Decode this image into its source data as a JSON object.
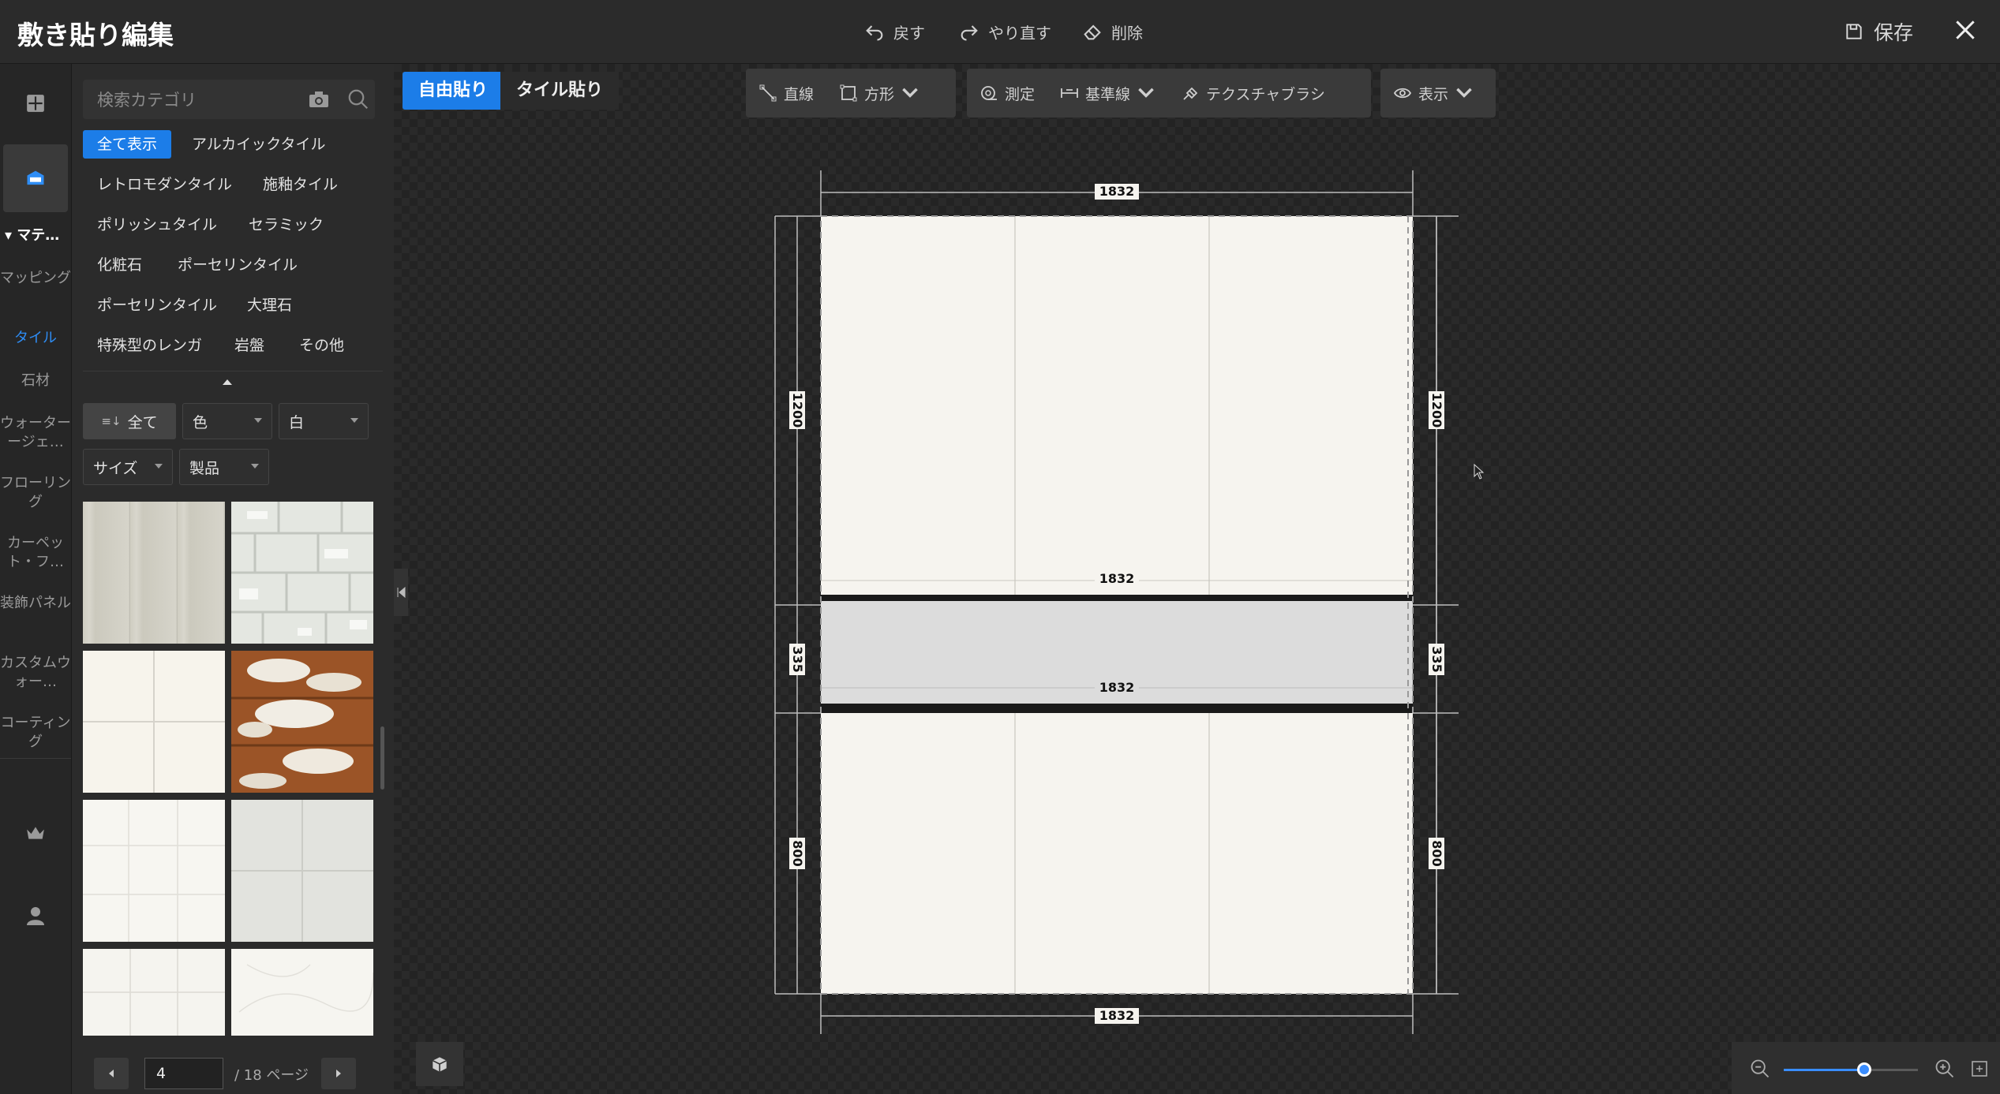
{
  "header": {
    "title": "敷き貼り編集",
    "undo_label": "戻す",
    "redo_label": "やり直す",
    "delete_label": "削除",
    "save_label": "保存"
  },
  "rail": {
    "section_label": "マテ…",
    "items": [
      "マッピング",
      "タイル",
      "石材",
      "ウォーターージェ…",
      "フローリング",
      "カーペット・フ…",
      "装飾パネル",
      "カスタムウォー…",
      "コーティング"
    ],
    "active_item": "タイル",
    "accent_color": "#1c7de8"
  },
  "panel": {
    "search_placeholder": "検索カテゴリ",
    "tags": [
      "全て表示",
      "アルカイックタイル",
      "レトロモダンタイル",
      "施釉タイル",
      "ポリッシュタイル",
      "セラミック",
      "化粧石",
      "ポーセリンタイル",
      "ポーセリンタイル",
      "大理石",
      "特殊型のレンガ",
      "岩盤",
      "その他"
    ],
    "active_tag": "全て表示",
    "filters": {
      "all_label": "全て",
      "color_label": "色",
      "color_value": "白",
      "size_label": "サイズ",
      "product_label": "製品"
    },
    "pager": {
      "current_page": "4",
      "total_label": "/ 18 ページ"
    }
  },
  "toolbar": {
    "mode_free": "自由貼り",
    "mode_tile": "タイル貼り",
    "active_mode": "自由貼り",
    "line": "直線",
    "rect": "方形",
    "measure": "測定",
    "baseline": "基準線",
    "texture_brush": "テクスチャブラシ",
    "display": "表示"
  },
  "drawing": {
    "width_top": "1832",
    "width_bottom": "1832",
    "section1_height": "1200",
    "section2_height": "335",
    "section3_height": "800",
    "label_mid1": "1832",
    "label_mid2": "1832",
    "tile_color": "#f6f4ef",
    "band_color": "#dcdcdc"
  },
  "zoom": {
    "level": 0.6
  }
}
